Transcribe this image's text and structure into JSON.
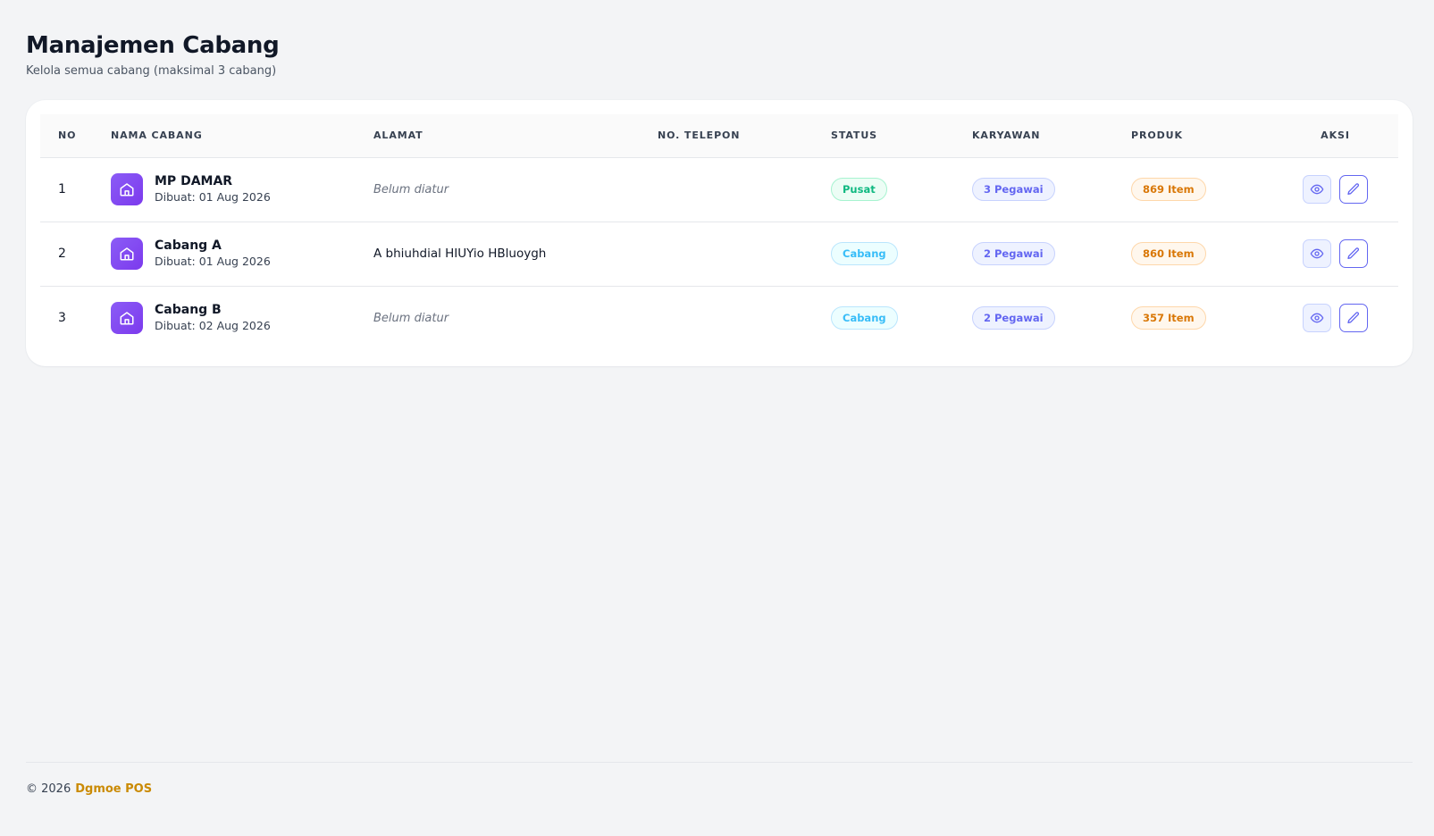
{
  "header": {
    "title": "Manajemen Cabang",
    "subtitle": "Kelola semua cabang (maksimal 3 cabang)"
  },
  "table": {
    "columns": {
      "no": "NO",
      "nama": "NAMA CABANG",
      "alamat": "ALAMAT",
      "telepon": "NO. TELEPON",
      "status": "STATUS",
      "karyawan": "KARYAWAN",
      "produk": "PRODUK",
      "aksi": "AKSI"
    },
    "rows": [
      {
        "no": "1",
        "name": "MP DAMAR",
        "created": "Dibuat: 01 Aug 2026",
        "address": "Belum diatur",
        "phone": "",
        "status": "Pusat",
        "employees": "3 Pegawai",
        "products": "869 Item"
      },
      {
        "no": "2",
        "name": "Cabang A",
        "created": "Dibuat: 01 Aug 2026",
        "address": "A bhiuhdial HIUYio HBluoygh",
        "phone": "",
        "status": "Cabang",
        "employees": "2 Pegawai",
        "products": "860 Item"
      },
      {
        "no": "3",
        "name": "Cabang B",
        "created": "Dibuat: 02 Aug 2026",
        "address": "Belum diatur",
        "phone": "",
        "status": "Cabang",
        "employees": "2 Pegawai",
        "products": "357 Item"
      }
    ]
  },
  "footer": {
    "copyright": "© 2026",
    "brand": "Dgmoe POS"
  },
  "icons": {
    "branch": "store-icon",
    "view": "eye-icon",
    "edit": "pencil-icon"
  },
  "colors": {
    "accent": "#7c3aed",
    "pusat": "#10b981",
    "cabang": "#38bdf8",
    "pegawai": "#6366f1",
    "produk": "#d97706",
    "brand": "#ca8a04"
  }
}
